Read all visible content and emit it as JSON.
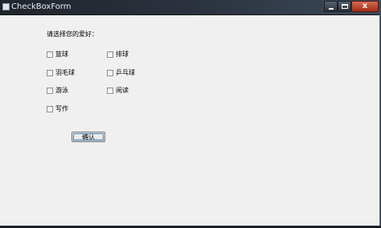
{
  "window": {
    "title": "CheckBoxForm",
    "close_glyph": "x"
  },
  "form": {
    "prompt": "请选择您的爱好：",
    "checkboxes": [
      {
        "label": "篮球",
        "checked": false
      },
      {
        "label": "排球",
        "checked": false
      },
      {
        "label": "羽毛球",
        "checked": false
      },
      {
        "label": "乒乓球",
        "checked": false
      },
      {
        "label": "游泳",
        "checked": false
      },
      {
        "label": "阅读",
        "checked": false
      },
      {
        "label": "写作",
        "checked": false
      }
    ],
    "confirm_label": "确认"
  },
  "icons": {
    "app": "app-window-icon",
    "minimize": "minimize-icon",
    "maximize": "maximize-icon",
    "close": "close-icon"
  },
  "colors": {
    "titlebar": "#2c3440",
    "window_background": "#f0f0f0",
    "close_button": "#c4482f"
  }
}
